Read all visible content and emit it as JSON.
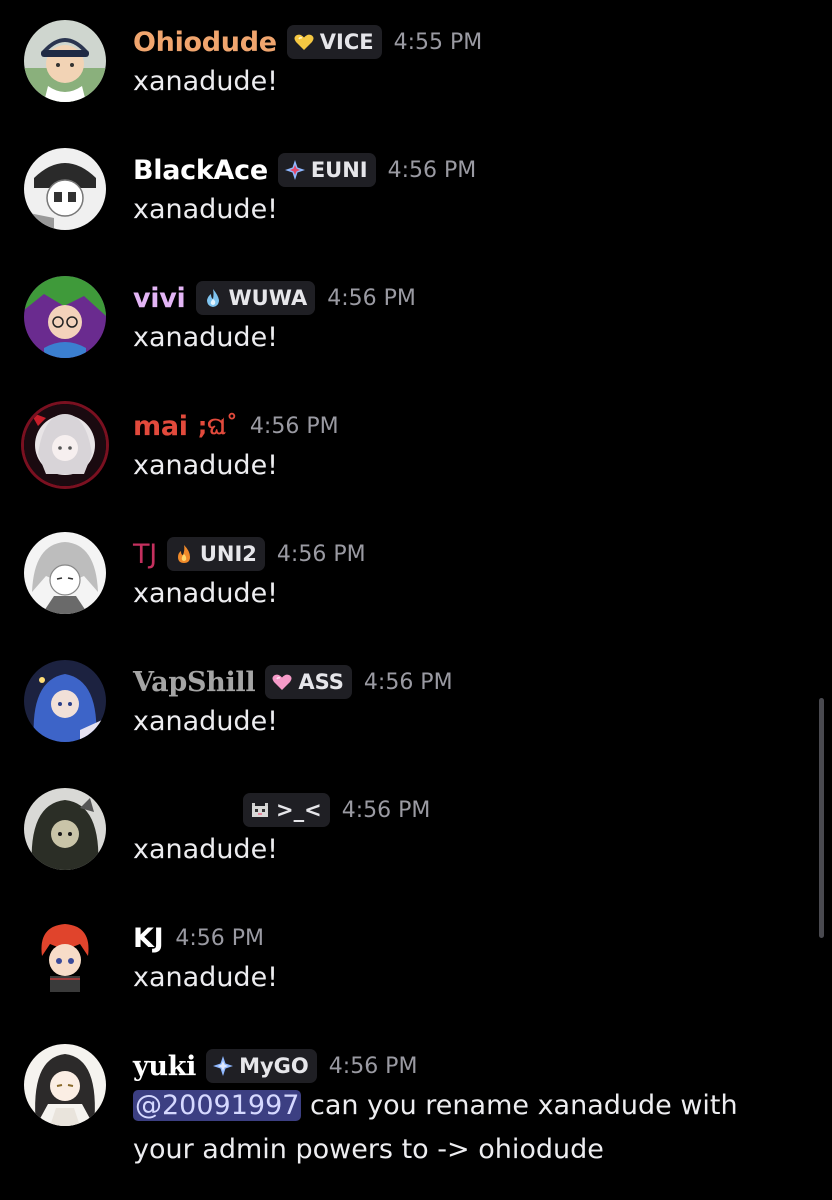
{
  "messages": [
    {
      "username": "Ohiodude",
      "color": "#f0a56e",
      "tag": "VICE",
      "tag_icon": "gold-heart-icon",
      "time": "4:55 PM",
      "text": "xanadude!"
    },
    {
      "username": "BlackAce",
      "color": "#ffffff",
      "tag": "EUNI",
      "tag_icon": "sparkle-star-icon",
      "time": "4:56 PM",
      "text": "xanadude!"
    },
    {
      "username": "vivi",
      "color": "#e3b5f5",
      "tag": "WUWA",
      "tag_icon": "blue-flame-icon",
      "time": "4:56 PM",
      "text": "xanadude!"
    },
    {
      "username": "mai",
      "color": "#e24a3c",
      "decoration": ";ଘ˚",
      "time": "4:56 PM",
      "text": "xanadude!"
    },
    {
      "username": "TJ",
      "color": "#c4305e",
      "tag": "UNI2",
      "tag_icon": "orange-flame-icon",
      "time": "4:56 PM",
      "text": "xanadude!"
    },
    {
      "username": "VapShill",
      "color": "#a5a5a5",
      "tag": "ASS",
      "tag_icon": "pink-heart-icon",
      "time": "4:56 PM",
      "text": "xanadude!"
    },
    {
      "username": "",
      "color": "#1e1e2a",
      "tag": ">_<",
      "tag_icon": "pixel-cat-icon",
      "time": "4:56 PM",
      "text": "xanadude!"
    },
    {
      "username": "KJ",
      "color": "#ffffff",
      "time": "4:56 PM",
      "text": "xanadude!"
    },
    {
      "username": "yuki",
      "color": "#ffffff",
      "tag": "MyGO",
      "tag_icon": "sparkle-star-icon",
      "time": "4:56 PM",
      "mention": "@20091997",
      "text": " can you rename xanadude with your admin powers to -> ohiodude"
    }
  ]
}
